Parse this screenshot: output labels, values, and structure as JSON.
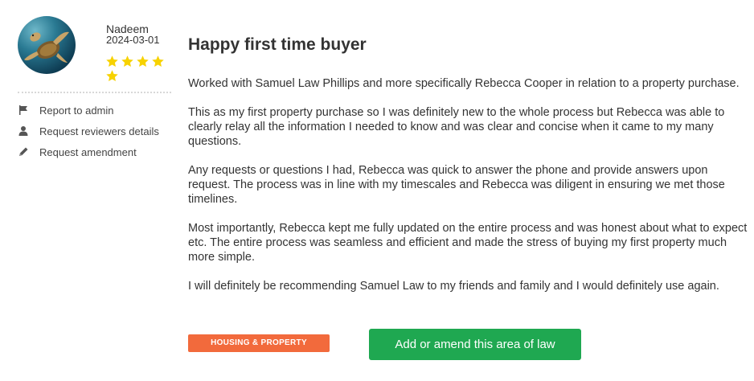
{
  "reviewer": {
    "name": "Nadeem",
    "date": "2024-03-01",
    "rating": 5,
    "star_color": "#f7d200"
  },
  "sidebar": {
    "links": [
      {
        "label": "Report to admin",
        "icon": "flag-icon"
      },
      {
        "label": "Request reviewers details",
        "icon": "user-icon"
      },
      {
        "label": "Request amendment",
        "icon": "pencil-icon"
      }
    ]
  },
  "review": {
    "title": "Happy first time buyer",
    "paragraphs": [
      "Worked with Samuel Law Phillips and more specifically Rebecca Cooper in relation to a property purchase.",
      "This as my first property purchase so I was definitely new to the whole process but Rebecca was able to clearly relay all the information I needed to know and was clear and concise when it came to my many questions.",
      "Any requests or questions I had, Rebecca was quick to answer the phone and provide answers upon request. The process was in line with my timescales and Rebecca was diligent in ensuring we met those timelines.",
      "Most importantly, Rebecca kept me fully updated on the entire process and was honest about what to expect etc. The entire process was seamless and efficient and made the stress of buying my first property much more simple.",
      "I will definitely be recommending Samuel Law to my friends and family and I would definitely use again."
    ]
  },
  "footer": {
    "tag_label": "HOUSING & PROPERTY",
    "tag_color": "#f26a3c",
    "add_button_label": "Add or amend this area of law",
    "add_button_color": "#1fa851"
  }
}
